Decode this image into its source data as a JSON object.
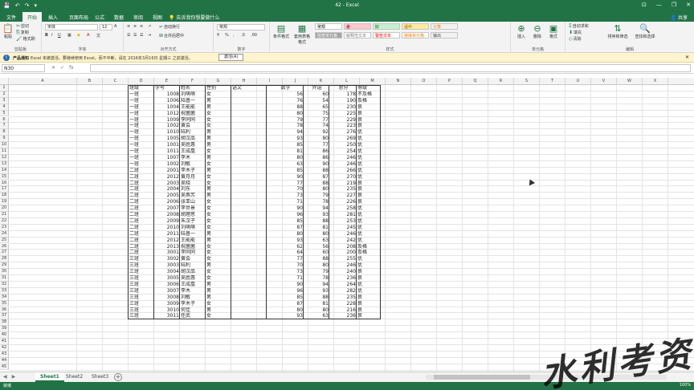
{
  "titlebar": {
    "title": "42 - Excel",
    "qat": [
      "💾",
      "↶",
      "↷",
      "▾"
    ],
    "window": [
      "⊡",
      "—",
      "❐",
      "✕"
    ]
  },
  "tabs": [
    {
      "label": "文件",
      "active": false
    },
    {
      "label": "开始",
      "active": true
    },
    {
      "label": "插入",
      "active": false
    },
    {
      "label": "页面布局",
      "active": false
    },
    {
      "label": "公式",
      "active": false
    },
    {
      "label": "数据",
      "active": false
    },
    {
      "label": "审阅",
      "active": false
    },
    {
      "label": "视图",
      "active": false
    }
  ],
  "tellme": "告诉我你想要做什么",
  "share": "共享",
  "ribbon": {
    "clipboard": {
      "paste": "粘贴",
      "cut": "剪切",
      "copy": "复制",
      "painter": "格式刷",
      "label": "剪贴板"
    },
    "font": {
      "name": "宋体",
      "size": "12",
      "label": "字体"
    },
    "align": {
      "wrap": "自动换行",
      "merge": "合并后居中",
      "label": "对齐方式"
    },
    "number": {
      "format": "常规",
      "label": "数字"
    },
    "styles": {
      "cond": "条件格式",
      "table": "套用表格格式",
      "boxes": [
        {
          "text": "常规",
          "bg": "#ffffff",
          "color": "#000000"
        },
        {
          "text": "差",
          "bg": "#ffc7ce",
          "color": "#9c0006"
        },
        {
          "text": "好",
          "bg": "#c6efce",
          "color": "#006100"
        },
        {
          "text": "适中",
          "bg": "#ffeb9c",
          "color": "#9c5700"
        },
        {
          "text": "计算",
          "bg": "#f2f2f2",
          "color": "#fa7d00"
        },
        {
          "text": "检查单元格",
          "bg": "#a5a5a5",
          "color": "#ffffff"
        },
        {
          "text": "解释性文本",
          "bg": "#ffffff",
          "color": "#7f7f7f"
        },
        {
          "text": "警告文本",
          "bg": "#ffffff",
          "color": "#ff0000"
        },
        {
          "text": "链接单元格",
          "bg": "#ffffff",
          "color": "#fa7d00"
        },
        {
          "text": "输出",
          "bg": "#f2f2f2",
          "color": "#3f3f3f"
        }
      ],
      "label": "样式"
    },
    "cells": {
      "insert": "插入",
      "delete": "删除",
      "format": "格式",
      "label": "单元格"
    },
    "editing": {
      "autosum": "自动求和",
      "fill": "填充",
      "clear": "清除",
      "sort": "排序和筛选",
      "find": "查找和选择",
      "label": "编辑"
    }
  },
  "notice": {
    "title": "产品通知",
    "text": "Excel 未被激活。要继续使用 Excel，而不中断，请在 2016年3月16日 星期三 之前激活。",
    "button": "激活(A)",
    "close": "✕"
  },
  "formula": {
    "namebox": "N30",
    "icons": [
      "✕",
      "✓",
      "fx"
    ],
    "value": ""
  },
  "columns": [
    "A",
    "B",
    "C",
    "D",
    "E",
    "F",
    "G",
    "H",
    "I",
    "J",
    "K",
    "L",
    "M",
    "N",
    "O",
    "P",
    "Q",
    "R",
    "S",
    "T",
    "U",
    "V",
    "W",
    "X"
  ],
  "rows_visible": 45,
  "headers": [
    "班级",
    "学号",
    "姓名",
    "性别",
    "语文",
    "数学",
    "外语",
    "总分",
    "等级"
  ],
  "rows": [
    [
      "一班",
      "1008",
      "刘萌萌",
      "女",
      "",
      "56",
      "60",
      "62",
      "178",
      "不及格"
    ],
    [
      "一班",
      "1006",
      "陆普一",
      "男",
      "",
      "76",
      "54",
      "60",
      "190",
      "及格"
    ],
    [
      "一班",
      "1004",
      "王能能",
      "男",
      "",
      "88",
      "65",
      "77",
      "230",
      "良"
    ],
    [
      "一班",
      "1012",
      "祝菌菌",
      "女",
      "",
      "80",
      "75",
      "70",
      "225",
      "良"
    ],
    [
      "一班",
      "1009",
      "李同同",
      "女",
      "",
      "79",
      "77",
      "73",
      "229",
      "良"
    ],
    [
      "一班",
      "1002",
      "黄会",
      "女",
      "",
      "78",
      "74",
      "71",
      "223",
      "良"
    ],
    [
      "一班",
      "1010",
      "陆利",
      "男",
      "",
      "94",
      "92",
      "90",
      "276",
      "优"
    ],
    [
      "一班",
      "1005",
      "胡汉品",
      "男",
      "",
      "93",
      "80",
      "96",
      "269",
      "优"
    ],
    [
      "一班",
      "1001",
      "吴胜惠",
      "男",
      "",
      "85",
      "77",
      "88",
      "250",
      "优"
    ],
    [
      "一班",
      "1011",
      "王成凰",
      "女",
      "",
      "81",
      "86",
      "87",
      "254",
      "优"
    ],
    [
      "一班",
      "1007",
      "李木",
      "男",
      "",
      "80",
      "86",
      "80",
      "246",
      "优"
    ],
    [
      "一班",
      "1002",
      "刘敏",
      "女",
      "",
      "63",
      "90",
      "93",
      "246",
      "优"
    ],
    [
      "二班",
      "2001",
      "李木子",
      "男",
      "",
      "85",
      "88",
      "93",
      "266",
      "优"
    ],
    [
      "二班",
      "2012",
      "黄月月",
      "女",
      "",
      "90",
      "87",
      "93",
      "270",
      "优"
    ],
    [
      "二班",
      "2003",
      "吴晓",
      "女",
      "",
      "77",
      "88",
      "54",
      "219",
      "良"
    ],
    [
      "二班",
      "2004",
      "刘东",
      "男",
      "",
      "70",
      "80",
      "85",
      "235",
      "良"
    ],
    [
      "二班",
      "2005",
      "吴燕芳",
      "男",
      "",
      "73",
      "79",
      "75",
      "227",
      "良"
    ],
    [
      "二班",
      "2006",
      "张亚山",
      "女",
      "",
      "71",
      "78",
      "77",
      "226",
      "良"
    ],
    [
      "二班",
      "2007",
      "李世景",
      "女",
      "",
      "90",
      "94",
      "74",
      "258",
      "优"
    ],
    [
      "二班",
      "2008",
      "胡理思",
      "女",
      "",
      "96",
      "93",
      "92",
      "281",
      "优"
    ],
    [
      "二班",
      "2009",
      "朱汉子",
      "女",
      "",
      "85",
      "88",
      "80",
      "253",
      "优"
    ],
    [
      "二班",
      "2010",
      "刘萌萌",
      "女",
      "",
      "87",
      "81",
      "77",
      "245",
      "优"
    ],
    [
      "二班",
      "2011",
      "陆普一",
      "男",
      "",
      "80",
      "80",
      "86",
      "246",
      "优"
    ],
    [
      "二班",
      "2012",
      "王能能",
      "男",
      "",
      "93",
      "63",
      "86",
      "242",
      "优"
    ],
    [
      "二班",
      "2013",
      "祝菌菌",
      "女",
      "",
      "62",
      "56",
      "90",
      "208",
      "及格"
    ],
    [
      "二班",
      "3001",
      "李同同",
      "女",
      "",
      "64",
      "60",
      "76",
      "200",
      "及格"
    ],
    [
      "三班",
      "3002",
      "黄会",
      "女",
      "",
      "77",
      "88",
      "90",
      "255",
      "优"
    ],
    [
      "三班",
      "3003",
      "陆利",
      "男",
      "",
      "70",
      "80",
      "96",
      "246",
      "优"
    ],
    [
      "三班",
      "3004",
      "胡汉品",
      "女",
      "",
      "73",
      "79",
      "88",
      "240",
      "良"
    ],
    [
      "三班",
      "3005",
      "吴胜惠",
      "女",
      "",
      "71",
      "78",
      "87",
      "236",
      "良"
    ],
    [
      "三班",
      "3006",
      "王成凰",
      "男",
      "",
      "90",
      "94",
      "80",
      "264",
      "优"
    ],
    [
      "三班",
      "3007",
      "李木",
      "男",
      "",
      "96",
      "93",
      "93",
      "282",
      "优"
    ],
    [
      "三班",
      "3008",
      "刘敏",
      "男",
      "",
      "85",
      "88",
      "62",
      "235",
      "良"
    ],
    [
      "三班",
      "3009",
      "李木子",
      "女",
      "",
      "87",
      "81",
      "60",
      "228",
      "良"
    ],
    [
      "三班",
      "3010",
      "何佳",
      "男",
      "",
      "80",
      "80",
      "56",
      "216",
      "良"
    ],
    [
      "三班",
      "3011",
      "任武",
      "女",
      "",
      "93",
      "63",
      "80",
      "236",
      "良"
    ]
  ],
  "sheets": [
    {
      "label": "Sheet1",
      "active": true
    },
    {
      "label": "Sheet2",
      "active": false
    },
    {
      "label": "Sheet3",
      "active": false
    }
  ],
  "sheet_nav": [
    "◀",
    "▶"
  ],
  "add_sheet": "+",
  "status": {
    "text": "就绪",
    "zoom": "100%"
  },
  "watermark": "水利考资"
}
